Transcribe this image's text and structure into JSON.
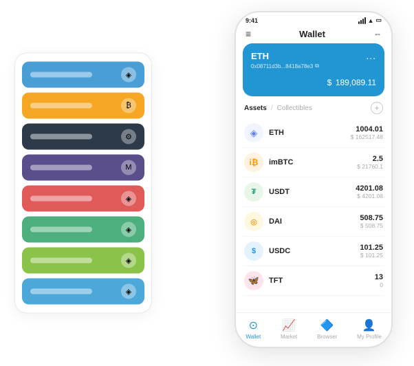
{
  "statusBar": {
    "time": "9:41",
    "signal": "signal",
    "wifi": "wifi",
    "battery": "battery"
  },
  "header": {
    "menuIcon": "≡",
    "title": "Wallet",
    "expandIcon": "⇔"
  },
  "ethCard": {
    "title": "ETH",
    "dots": "...",
    "address": "0x08711d3b...8418a78e3",
    "copyIcon": "⧉",
    "amountLabel": "$",
    "amount": "189,089.11"
  },
  "assetsHeader": {
    "activeTab": "Assets",
    "slash": "/",
    "inactiveTab": "Collectibles",
    "addIcon": "+"
  },
  "assets": [
    {
      "symbol": "ETH",
      "icon": "◈",
      "iconClass": "icon-eth",
      "amount": "1004.01",
      "usd": "$ 162517.48"
    },
    {
      "symbol": "imBTC",
      "icon": "₿",
      "iconClass": "icon-imbtc",
      "amount": "2.5",
      "usd": "$ 21760.1"
    },
    {
      "symbol": "USDT",
      "icon": "₮",
      "iconClass": "icon-usdt",
      "amount": "4201.08",
      "usd": "$ 4201.08"
    },
    {
      "symbol": "DAI",
      "icon": "◎",
      "iconClass": "icon-dai",
      "amount": "508.75",
      "usd": "$ 508.75"
    },
    {
      "symbol": "USDC",
      "icon": "$",
      "iconClass": "icon-usdc",
      "amount": "101.25",
      "usd": "$ 101.25"
    },
    {
      "symbol": "TFT",
      "icon": "🦋",
      "iconClass": "icon-tft",
      "amount": "13",
      "usd": "0"
    }
  ],
  "bottomNav": [
    {
      "label": "Wallet",
      "icon": "⊙",
      "active": true
    },
    {
      "label": "Market",
      "icon": "📊",
      "active": false
    },
    {
      "label": "Browser",
      "icon": "🌐",
      "active": false
    },
    {
      "label": "My Profile",
      "icon": "👤",
      "active": false
    }
  ],
  "cardStack": [
    {
      "color": "card-blue",
      "iconText": "◈"
    },
    {
      "color": "card-orange",
      "iconText": "₿"
    },
    {
      "color": "card-dark",
      "iconText": "⚙"
    },
    {
      "color": "card-purple",
      "iconText": "M"
    },
    {
      "color": "card-red",
      "iconText": "◈"
    },
    {
      "color": "card-green",
      "iconText": "◈"
    },
    {
      "color": "card-lightgreen",
      "iconText": "◈"
    },
    {
      "color": "card-skyblue",
      "iconText": "◈"
    }
  ]
}
